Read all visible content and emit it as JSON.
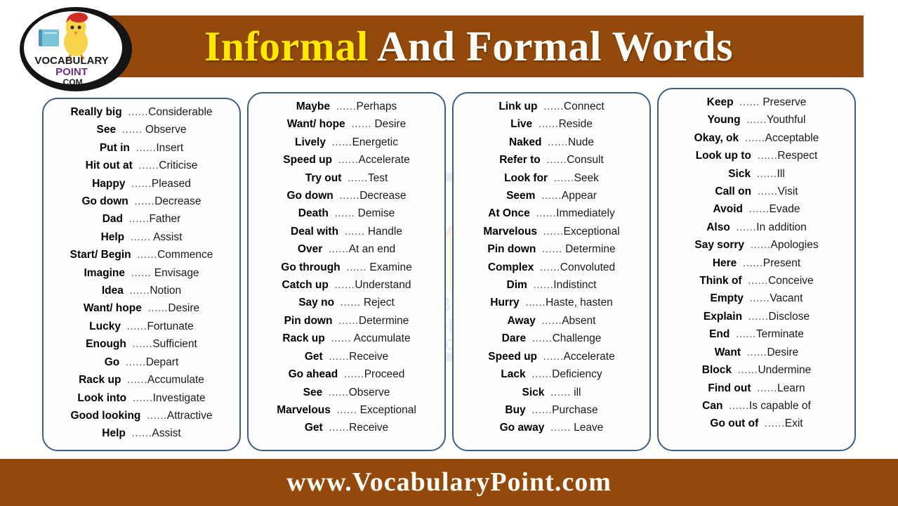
{
  "header": {
    "title_highlight": "Informal",
    "title_rest": " And Formal Words",
    "band_color": "#93490b",
    "highlight_color": "#ffe800",
    "rest_color": "#ffffff"
  },
  "logo": {
    "line1": "VOCABULARY",
    "line2": "POINT",
    "line3": ".COM",
    "icon": "chick-with-book-logo"
  },
  "watermark": {
    "line1": "VOCABULARY",
    "line2": "POINT",
    "line3": ".COM"
  },
  "footer": {
    "text": "www.VocabularyPoint.com",
    "band_color": "#93490b"
  },
  "card_style": {
    "border_color": "#3d5e80",
    "background": "#fdfdfd"
  },
  "columns": [
    {
      "id": "column-1",
      "rows": [
        {
          "informal": "Really big",
          "dots": "......",
          "formal": "Considerable"
        },
        {
          "informal": "See",
          "dots": "......",
          "formal": " Observe"
        },
        {
          "informal": "Put in",
          "dots": "......",
          "formal": "Insert"
        },
        {
          "informal": "Hit out at",
          "dots": "......",
          "formal": "Criticise"
        },
        {
          "informal": "Happy",
          "dots": "......",
          "formal": "Pleased"
        },
        {
          "informal": "Go down",
          "dots": "......",
          "formal": "Decrease"
        },
        {
          "informal": "Dad",
          "dots": "......",
          "formal": "Father"
        },
        {
          "informal": "Help",
          "dots": "......",
          "formal": " Assist"
        },
        {
          "informal": "Start/ Begin",
          "dots": "......",
          "formal": "Commence"
        },
        {
          "informal": "Imagine",
          "dots": "......",
          "formal": " Envisage"
        },
        {
          "informal": "Idea",
          "dots": "......",
          "formal": "Notion"
        },
        {
          "informal": "Want/ hope",
          "dots": "......",
          "formal": "Desire"
        },
        {
          "informal": "Lucky",
          "dots": "......",
          "formal": "Fortunate"
        },
        {
          "informal": "Enough",
          "dots": "......",
          "formal": "Sufficient"
        },
        {
          "informal": "Go",
          "dots": "......",
          "formal": "Depart"
        },
        {
          "informal": "Rack up",
          "dots": "......",
          "formal": "Accumulate"
        },
        {
          "informal": "Look into",
          "dots": "......",
          "formal": "Investigate"
        },
        {
          "informal": "Good looking",
          "dots": "......",
          "formal": "Attractive"
        },
        {
          "informal": "Help",
          "dots": "......",
          "formal": "Assist"
        }
      ]
    },
    {
      "id": "column-2",
      "rows": [
        {
          "informal": "Maybe",
          "dots": "......",
          "formal": "Perhaps"
        },
        {
          "informal": "Want/ hope",
          "dots": "......",
          "formal": " Desire"
        },
        {
          "informal": "Lively",
          "dots": "......",
          "formal": "Energetic"
        },
        {
          "informal": "Speed up",
          "dots": "......",
          "formal": "Accelerate"
        },
        {
          "informal": "Try out",
          "dots": "......",
          "formal": "Test"
        },
        {
          "informal": "Go down",
          "dots": "......",
          "formal": "Decrease"
        },
        {
          "informal": "Death",
          "dots": "......",
          "formal": " Demise"
        },
        {
          "informal": "Deal with",
          "dots": "......",
          "formal": " Handle"
        },
        {
          "informal": "Over",
          "dots": "......",
          "formal": "At an end"
        },
        {
          "informal": "Go through",
          "dots": "......",
          "formal": " Examine"
        },
        {
          "informal": "Catch up",
          "dots": "......",
          "formal": "Understand"
        },
        {
          "informal": "Say no",
          "dots": "......",
          "formal": " Reject"
        },
        {
          "informal": "Pin down",
          "dots": "......",
          "formal": "Determine"
        },
        {
          "informal": "Rack up",
          "dots": "......",
          "formal": " Accumulate"
        },
        {
          "informal": "Get",
          "dots": "......",
          "formal": "Receive"
        },
        {
          "informal": "Go ahead",
          "dots": "......",
          "formal": "Proceed"
        },
        {
          "informal": "See",
          "dots": "......",
          "formal": "Observe"
        },
        {
          "informal": "Marvelous",
          "dots": "......",
          "formal": " Exceptional"
        },
        {
          "informal": "Get",
          "dots": "......",
          "formal": "Receive"
        }
      ]
    },
    {
      "id": "column-3",
      "rows": [
        {
          "informal": "Link up",
          "dots": "......",
          "formal": "Connect"
        },
        {
          "informal": "Live",
          "dots": "......",
          "formal": "Reside"
        },
        {
          "informal": "Naked",
          "dots": "......",
          "formal": "Nude"
        },
        {
          "informal": "Refer to",
          "dots": "......",
          "formal": "Consult"
        },
        {
          "informal": "Look for",
          "dots": "......",
          "formal": "Seek"
        },
        {
          "informal": "Seem",
          "dots": "......",
          "formal": "Appear"
        },
        {
          "informal": "At Once",
          "dots": "......",
          "formal": "Immediately"
        },
        {
          "informal": "Marvelous",
          "dots": "......",
          "formal": "Exceptional"
        },
        {
          "informal": "Pin down",
          "dots": "......",
          "formal": " Determine"
        },
        {
          "informal": "Complex",
          "dots": "......",
          "formal": "Convoluted"
        },
        {
          "informal": "Dim",
          "dots": "......",
          "formal": "Indistinct"
        },
        {
          "informal": "Hurry",
          "dots": "......",
          "formal": "Haste, hasten"
        },
        {
          "informal": "Away",
          "dots": "......",
          "formal": "Absent"
        },
        {
          "informal": "Dare",
          "dots": "......",
          "formal": "Challenge"
        },
        {
          "informal": "Speed up",
          "dots": "......",
          "formal": "Accelerate"
        },
        {
          "informal": "Lack",
          "dots": "......",
          "formal": "Deficiency"
        },
        {
          "informal": "Sick",
          "dots": "......",
          "formal": " ill"
        },
        {
          "informal": "Buy",
          "dots": "......",
          "formal": "Purchase"
        },
        {
          "informal": "Go away",
          "dots": "......",
          "formal": " Leave"
        }
      ]
    },
    {
      "id": "column-4",
      "rows": [
        {
          "informal": "Keep",
          "dots": "......",
          "formal": " Preserve"
        },
        {
          "informal": "Young",
          "dots": "......",
          "formal": "Youthful"
        },
        {
          "informal": "Okay, ok",
          "dots": "......",
          "formal": "Acceptable"
        },
        {
          "informal": "Look up to",
          "dots": "......",
          "formal": "Respect"
        },
        {
          "informal": "Sick",
          "dots": "......",
          "formal": "Ill"
        },
        {
          "informal": "Call on",
          "dots": "......",
          "formal": "Visit"
        },
        {
          "informal": "Avoid",
          "dots": "......",
          "formal": "Evade"
        },
        {
          "informal": "Also",
          "dots": "......",
          "formal": "In addition"
        },
        {
          "informal": "Say sorry",
          "dots": "......",
          "formal": "Apologies"
        },
        {
          "informal": "Here",
          "dots": "......",
          "formal": "Present"
        },
        {
          "informal": "Think of",
          "dots": "......",
          "formal": "Conceive"
        },
        {
          "informal": "Empty",
          "dots": "......",
          "formal": "Vacant"
        },
        {
          "informal": "Explain",
          "dots": "......",
          "formal": "Disclose"
        },
        {
          "informal": "End",
          "dots": "......",
          "formal": "Terminate"
        },
        {
          "informal": "Want",
          "dots": "......",
          "formal": "Desire"
        },
        {
          "informal": "Block",
          "dots": "......",
          "formal": "Undermine"
        },
        {
          "informal": "Find out",
          "dots": "......",
          "formal": "Learn"
        },
        {
          "informal": "Can",
          "dots": "......",
          "formal": "Is capable of"
        },
        {
          "informal": "Go out of",
          "dots": "......",
          "formal": "Exit"
        }
      ]
    }
  ]
}
